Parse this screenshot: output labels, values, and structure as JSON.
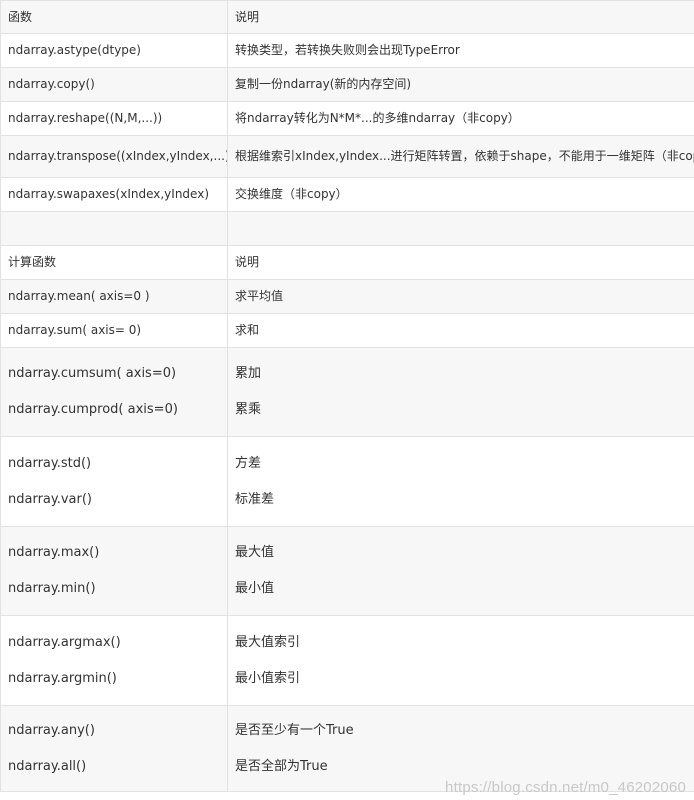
{
  "table": {
    "section1": {
      "header": [
        "函数",
        "说明"
      ],
      "rows": [
        [
          "ndarray.astype(dtype)",
          "转换类型，若转换失败则会出现TypeError"
        ],
        [
          "ndarray.copy()",
          "复制一份ndarray(新的内存空间)"
        ],
        [
          "ndarray.reshape((N,M,...))",
          "将ndarray转化为N*M*...的多维ndarray（非copy）"
        ],
        [
          "ndarray.transpose((xIndex,yIndex,...))",
          "根据维索引xIndex,yIndex...进行矩阵转置，依赖于shape，不能用于一维矩阵（非copy）"
        ],
        [
          "ndarray.swapaxes(xIndex,yIndex)",
          "交换维度（非copy）"
        ]
      ]
    },
    "section2": {
      "header": [
        "计算函数",
        "说明"
      ],
      "rows": [
        [
          "ndarray.mean( axis=0 )",
          "求平均值"
        ],
        [
          "ndarray.sum( axis= 0)",
          "求和"
        ]
      ],
      "groups": [
        {
          "funcs": [
            "ndarray.cumsum( axis=0)",
            "ndarray.cumprod( axis=0)"
          ],
          "descs": [
            "累加",
            "累乘"
          ]
        },
        {
          "funcs": [
            "ndarray.std()",
            "ndarray.var()"
          ],
          "descs": [
            "方差",
            "标准差"
          ]
        },
        {
          "funcs": [
            "ndarray.max()",
            "ndarray.min()"
          ],
          "descs": [
            "最大值",
            "最小值"
          ]
        },
        {
          "funcs": [
            "ndarray.argmax()",
            "ndarray.argmin()"
          ],
          "descs": [
            "最大值索引",
            "最小值索引"
          ]
        },
        {
          "funcs": [
            "ndarray.any()",
            "ndarray.all()"
          ],
          "descs": [
            "是否至少有一个True",
            "是否全部为True"
          ]
        }
      ]
    }
  },
  "watermark": "https://blog.csdn.net/m0_46202060"
}
